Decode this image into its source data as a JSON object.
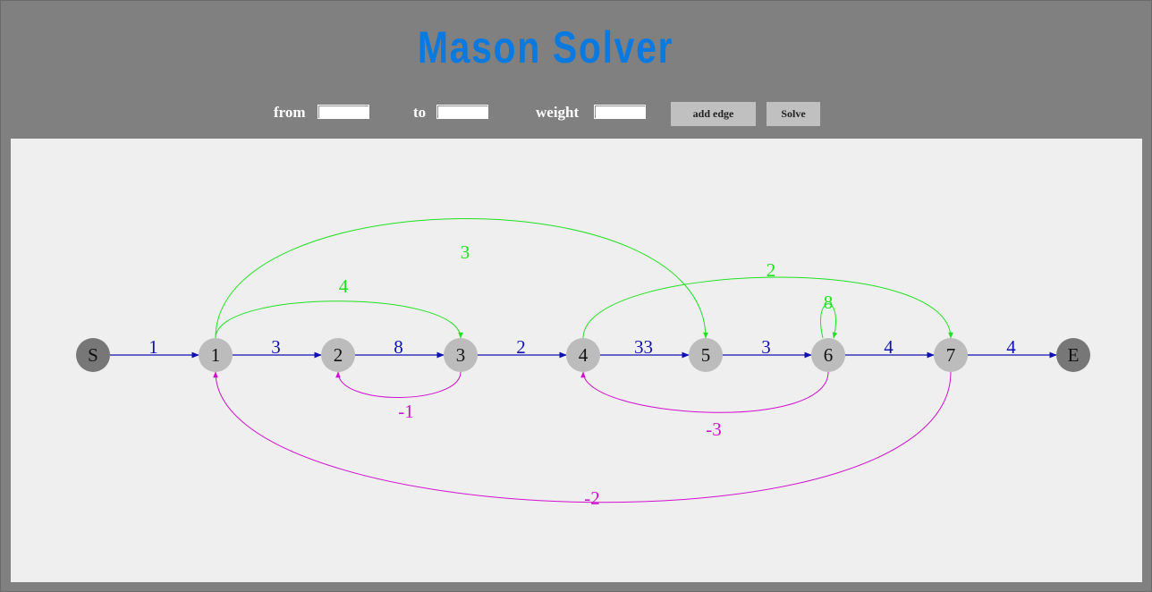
{
  "header": {
    "title": "Mason Solver"
  },
  "controls": {
    "from_label": "from",
    "to_label": "to",
    "weight_label": "weight",
    "from_value": "",
    "to_value": "",
    "weight_value": "",
    "add_edge_label": "add edge",
    "solve_label": "Solve"
  },
  "colors": {
    "forward_edge": "#1010b0",
    "feedback_positive": "#22e022",
    "feedback_negative": "#d010d0",
    "terminal_node": "#777777",
    "internal_node": "#bcbcbc",
    "title": "#0a7ae0"
  },
  "graph": {
    "nodes": [
      "S",
      "1",
      "2",
      "3",
      "4",
      "5",
      "6",
      "7",
      "E"
    ],
    "edges": [
      {
        "from": "S",
        "to": "1",
        "weight": "1",
        "kind": "forward"
      },
      {
        "from": "1",
        "to": "2",
        "weight": "3",
        "kind": "forward"
      },
      {
        "from": "2",
        "to": "3",
        "weight": "8",
        "kind": "forward"
      },
      {
        "from": "3",
        "to": "4",
        "weight": "2",
        "kind": "forward"
      },
      {
        "from": "4",
        "to": "5",
        "weight": "33",
        "kind": "forward"
      },
      {
        "from": "5",
        "to": "6",
        "weight": "3",
        "kind": "forward"
      },
      {
        "from": "6",
        "to": "7",
        "weight": "4",
        "kind": "forward"
      },
      {
        "from": "7",
        "to": "E",
        "weight": "4",
        "kind": "forward"
      },
      {
        "from": "1",
        "to": "5",
        "weight": "3",
        "kind": "skip"
      },
      {
        "from": "1",
        "to": "3",
        "weight": "4",
        "kind": "skip"
      },
      {
        "from": "4",
        "to": "7",
        "weight": "2",
        "kind": "skip"
      },
      {
        "from": "6",
        "to": "6",
        "weight": "8",
        "kind": "self-loop"
      },
      {
        "from": "3",
        "to": "2",
        "weight": "-1",
        "kind": "feedback"
      },
      {
        "from": "6",
        "to": "4",
        "weight": "-3",
        "kind": "feedback"
      },
      {
        "from": "7",
        "to": "1",
        "weight": "-2",
        "kind": "feedback"
      }
    ]
  }
}
